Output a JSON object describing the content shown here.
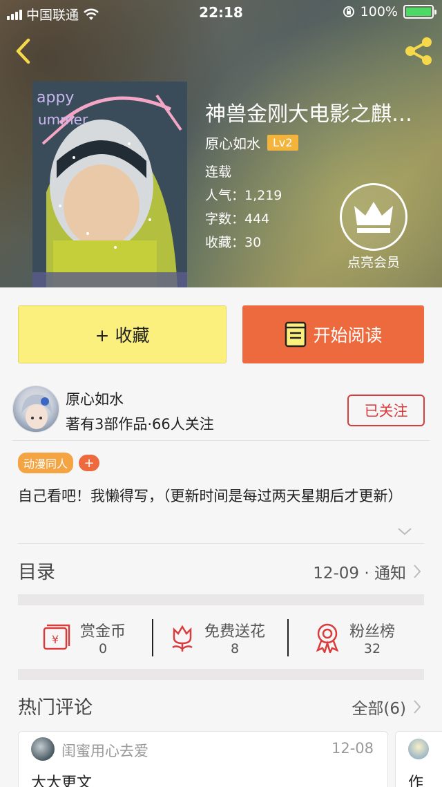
{
  "status_bar": {
    "carrier": "中国联通",
    "time": "22:18",
    "battery_percent": "100%",
    "battery_level": 1.0
  },
  "book": {
    "title": "神兽金刚大电影之麒…",
    "author": "原心如水",
    "level": "Lv2",
    "status": "连载",
    "popularity": "人气：1,219",
    "word_count": "字数：444",
    "favorites": "收藏：30",
    "vip_label": "点亮会员"
  },
  "actions": {
    "collect_label": "+ 收藏",
    "read_label": "开始阅读"
  },
  "author_card": {
    "name": "原心如水",
    "info": "著有3部作品·66人关注",
    "follow_label": "已关注"
  },
  "tags": [
    "动漫同人"
  ],
  "intro": "自己看吧！我懒得写，（更新时间是每过两天星期后才更新）",
  "catalog": {
    "title": "目录",
    "latest": "12-09 · 通知"
  },
  "stats": [
    {
      "label": "赏金币",
      "value": "0",
      "icon": "red-envelope-icon"
    },
    {
      "label": "免费送花",
      "value": "8",
      "icon": "flower-icon"
    },
    {
      "label": "粉丝榜",
      "value": "32",
      "icon": "medal-icon"
    }
  ],
  "hot_comments": {
    "title": "热门评论",
    "all_label": "全部(6)",
    "items": [
      {
        "user": "闺蜜用心去爱",
        "date": "12-08",
        "text": "大大更文"
      },
      {
        "user": "",
        "date": "",
        "text": "作"
      }
    ]
  },
  "colors": {
    "collect_button": "#fbf07e",
    "read_button": "#ec6a3d",
    "follow_border": "#d83c3c",
    "level_badge": "#f4b33a",
    "tag": "#f4a443",
    "battery": "#4cd964"
  }
}
